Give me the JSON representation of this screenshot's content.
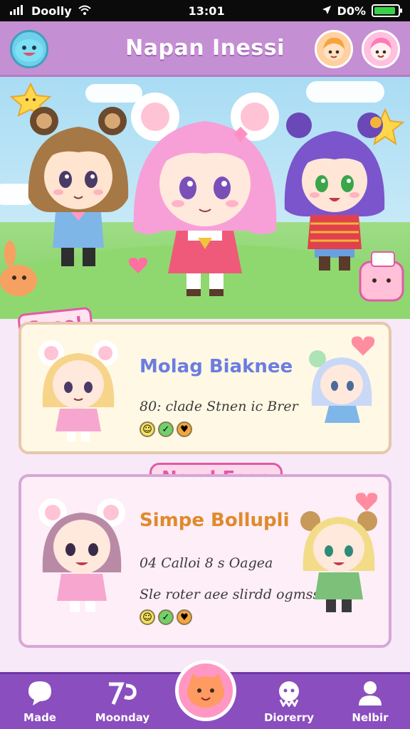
{
  "status": {
    "carrier": "Doolly",
    "time": "13:01",
    "battery_text": "D0%",
    "battery_level": 0.9
  },
  "header": {
    "title": "Napan Inessi"
  },
  "section": {
    "tag": "Sooo!"
  },
  "card1": {
    "title": "Molag Biaknee",
    "text": "80: clade Stnen ic Brer"
  },
  "banner": {
    "label": "Nand Faos"
  },
  "card2": {
    "title": "Simpe Bollupli",
    "line1": "04 Calloi 8 s Oagea",
    "line2": "Sle roter aee slirdd ogmsset"
  },
  "nav": {
    "items": [
      {
        "label": "Made"
      },
      {
        "label": "Moonday"
      },
      {
        "label": "Diorerry"
      },
      {
        "label": "Nelbir"
      }
    ]
  },
  "colors": {
    "header": "#c58fd3",
    "nav": "#8a4ebf",
    "accent_pink": "#e05aa6",
    "card1_bg": "#fff8e4",
    "card2_bg": "#fdeef7"
  }
}
